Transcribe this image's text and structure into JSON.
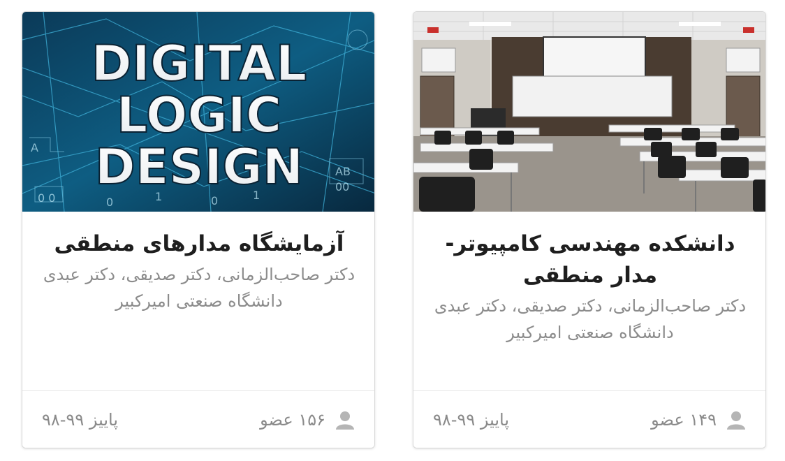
{
  "cards": [
    {
      "image": {
        "kind": "digital-logic-cover",
        "lines": [
          "DIGITAL",
          "LOGIC",
          "DESIGN"
        ]
      },
      "title": "آزمایشگاه مدارهای منطقی",
      "instructors": "دکتر صاحب‌الزمانی، دکتر صدیقی، دکتر عبدی",
      "university": "دانشگاه صنعتی امیرکبیر",
      "members": "۱۵۶ عضو",
      "term": "پاییز ۹۹-۹۸"
    },
    {
      "image": {
        "kind": "classroom-photo"
      },
      "title": "دانشکده مهندسی کامپیوتر- مدار منطقی",
      "instructors": "دکتر صاحب‌الزمانی، دکتر صدیقی، دکتر عبدی",
      "university": "دانشگاه صنعتی امیرکبیر",
      "members": "۱۴۹ عضو",
      "term": "پاییز ۹۹-۹۸"
    }
  ],
  "icons": {
    "member": "user-icon"
  },
  "colors": {
    "title": "#1e1e1e",
    "muted_text": "#8c8c8c",
    "border": "#d9d9d9"
  }
}
